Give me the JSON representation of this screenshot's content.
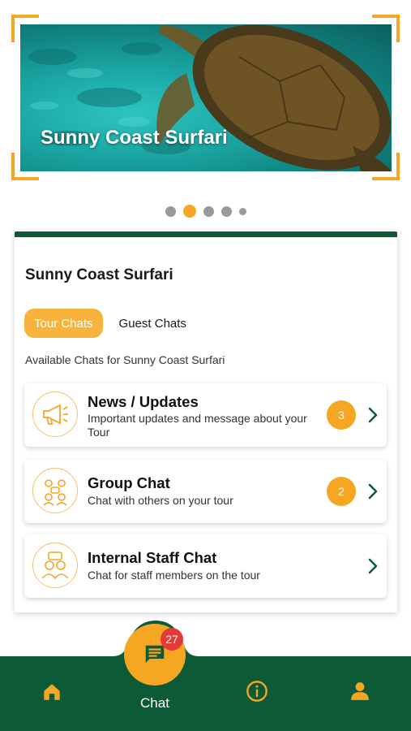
{
  "hero": {
    "title": "Sunny Coast Surfari"
  },
  "carousel": {
    "count": 5,
    "active_index": 1
  },
  "card": {
    "title": "Sunny Coast Surfari",
    "tabs": [
      {
        "label": "Tour Chats",
        "active": true
      },
      {
        "label": "Guest Chats",
        "active": false
      }
    ],
    "subtitle": "Available Chats for Sunny Coast Surfari",
    "chats": [
      {
        "title": "News / Updates",
        "description": "Important updates and message about your Tour",
        "badge": "3",
        "icon": "megaphone-icon"
      },
      {
        "title": "Group Chat",
        "description": "Chat with others on your tour",
        "badge": "2",
        "icon": "group-chat-icon"
      },
      {
        "title": "Internal Staff Chat",
        "description": "Chat for staff members on the tour",
        "badge": null,
        "icon": "staff-chat-icon"
      }
    ]
  },
  "nav": {
    "chat_label": "Chat",
    "chat_badge": "27",
    "items": [
      "home-icon",
      "chat-icon",
      "info-icon",
      "profile-icon"
    ]
  },
  "colors": {
    "accent": "#f5a623",
    "brand_green": "#0c5a36",
    "badge_red": "#e53935"
  }
}
